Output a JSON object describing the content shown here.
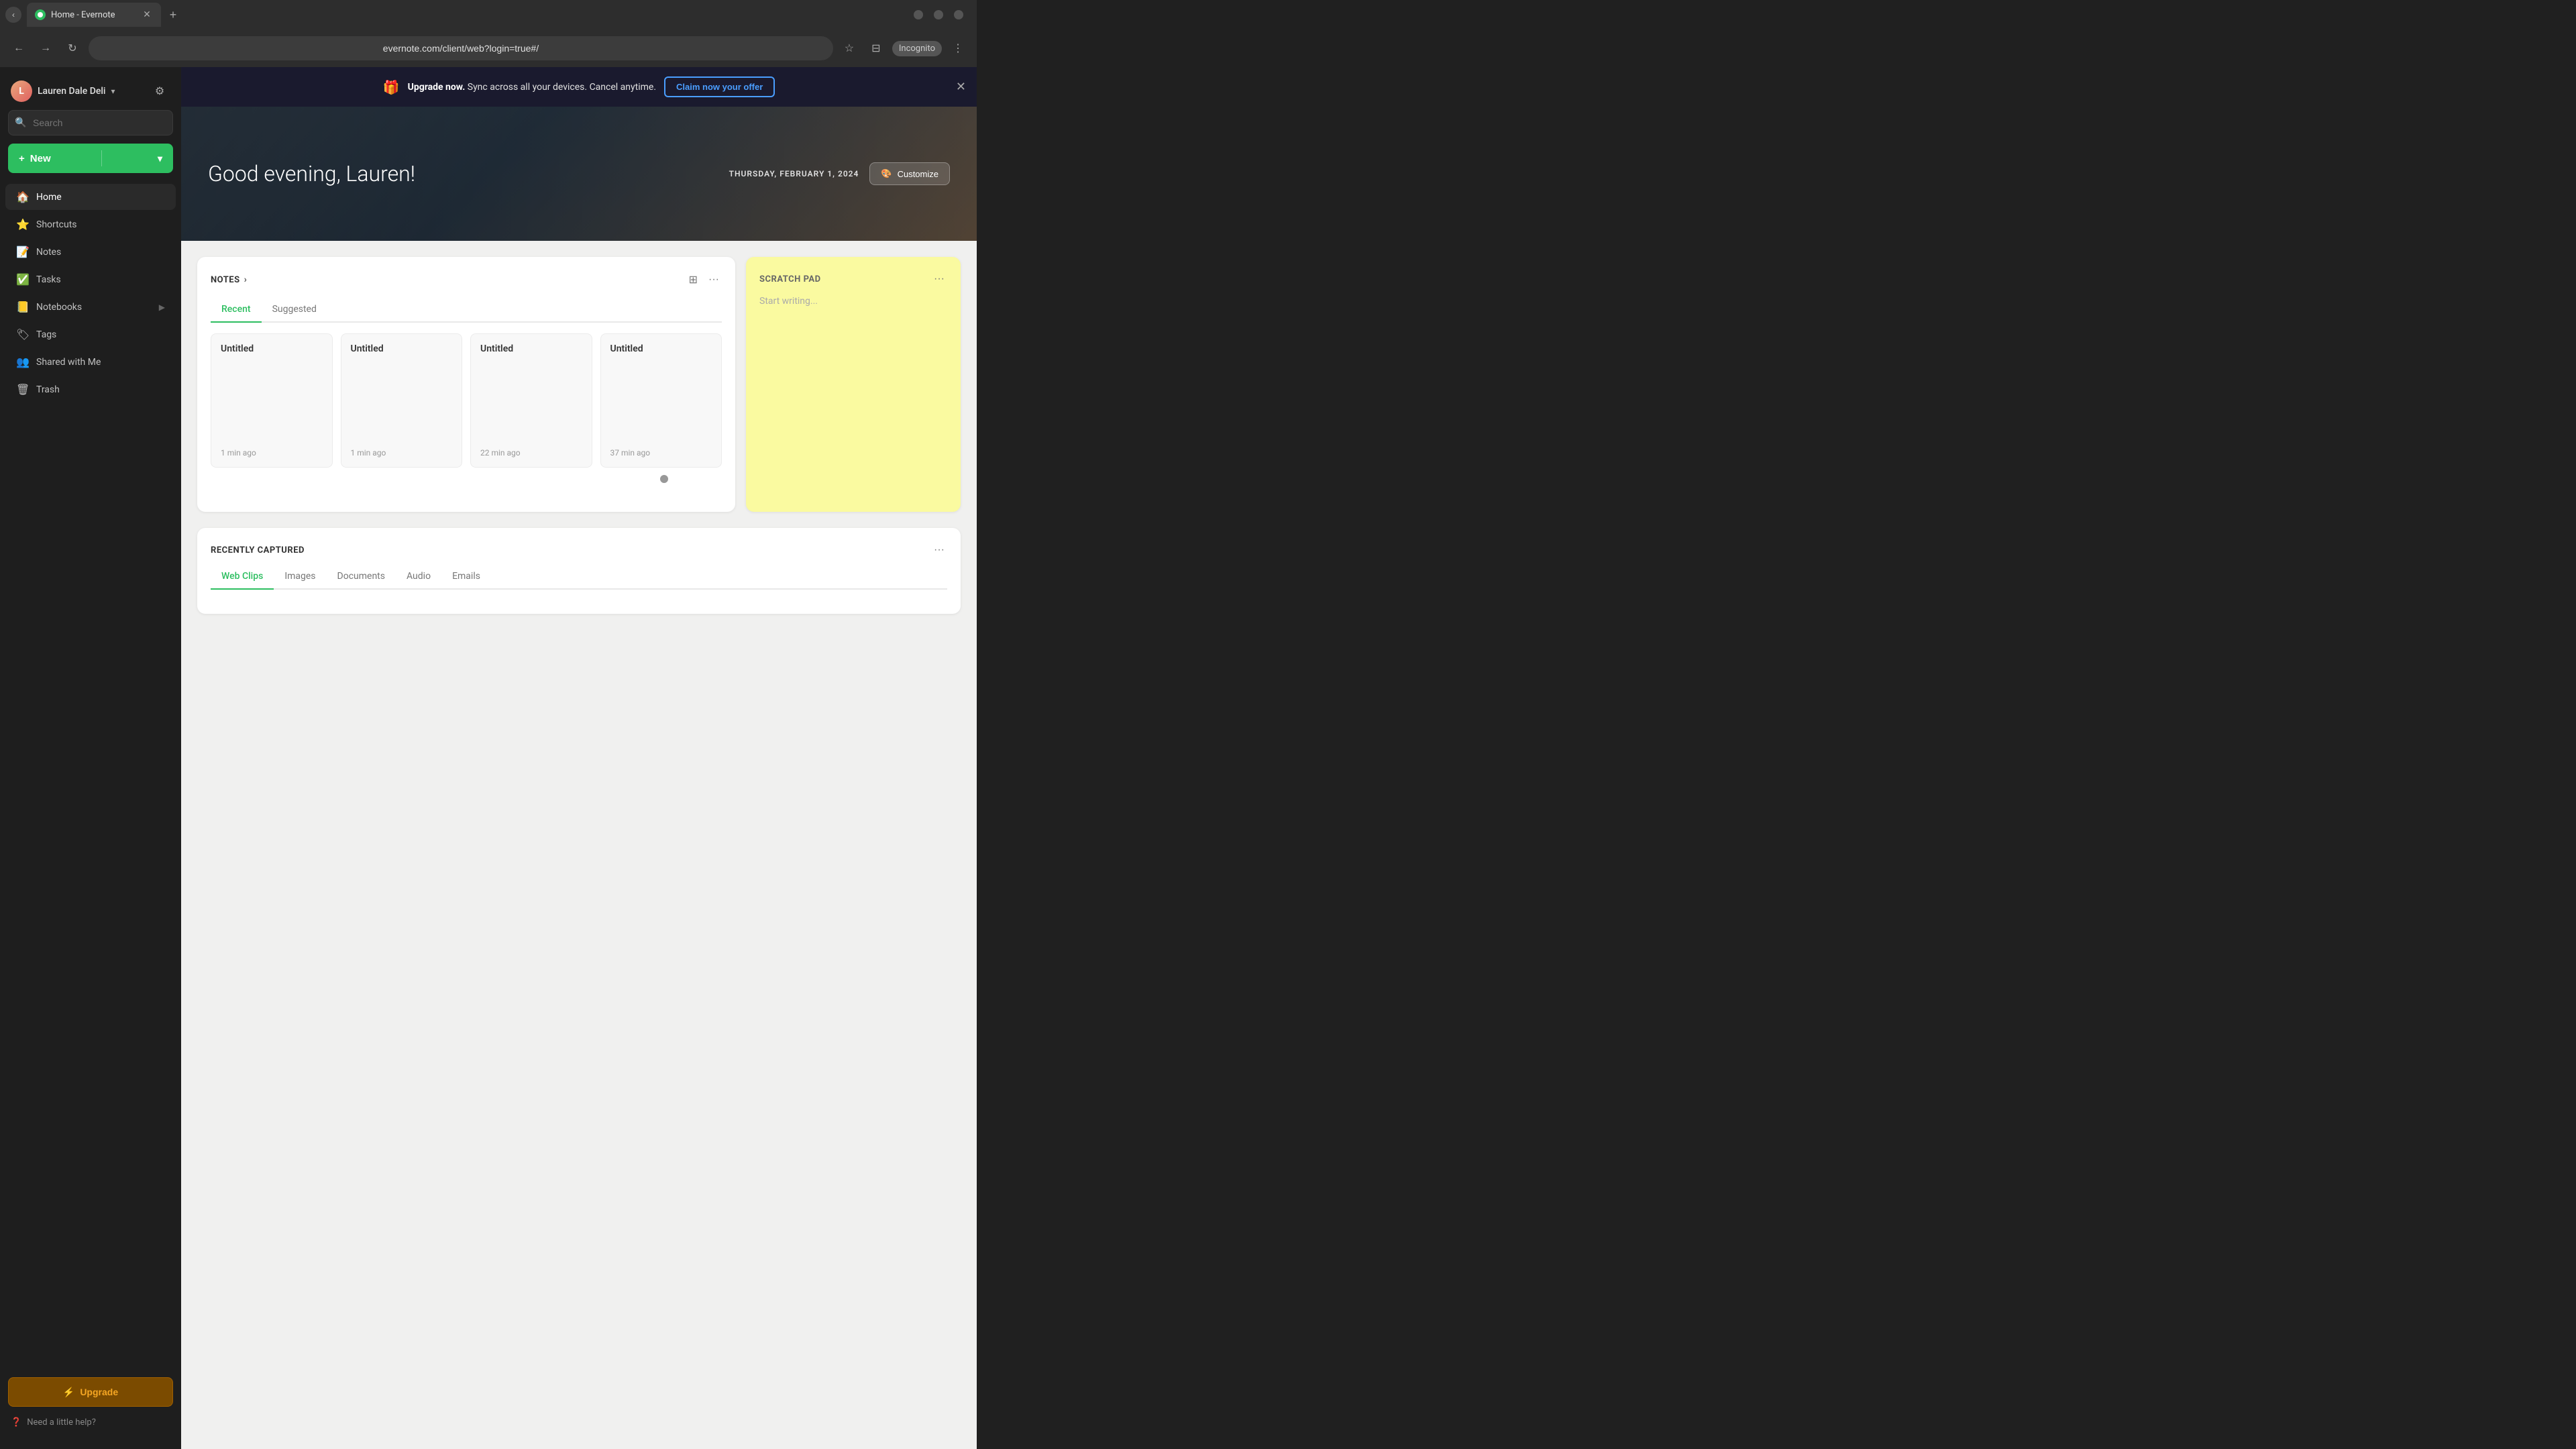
{
  "browser": {
    "tab_title": "Home - Evernote",
    "favicon_color": "#2dbe60",
    "url": "evernote.com/client/web?login=true#/",
    "incognito_label": "Incognito",
    "new_tab_tooltip": "New tab"
  },
  "banner": {
    "icon": "🎁",
    "text_before": "Upgrade now.",
    "text_main": " Sync across all your devices. Cancel anytime.",
    "cta_label": "Claim now your offer"
  },
  "header": {
    "greeting": "Good evening, Lauren!",
    "date": "THURSDAY, FEBRUARY 1, 2024",
    "customize_label": "Customize"
  },
  "sidebar": {
    "username": "Lauren Dale Deli",
    "search_placeholder": "Search",
    "new_button_label": "New",
    "nav_items": [
      {
        "id": "home",
        "label": "Home",
        "icon": "🏠"
      },
      {
        "id": "shortcuts",
        "label": "Shortcuts",
        "icon": "⭐"
      },
      {
        "id": "notes",
        "label": "Notes",
        "icon": "📝"
      },
      {
        "id": "tasks",
        "label": "Tasks",
        "icon": "✅"
      },
      {
        "id": "notebooks",
        "label": "Notebooks",
        "icon": "📒"
      },
      {
        "id": "tags",
        "label": "Tags",
        "icon": "🏷"
      },
      {
        "id": "shared",
        "label": "Shared with Me",
        "icon": "👥"
      },
      {
        "id": "trash",
        "label": "Trash",
        "icon": "🗑"
      }
    ],
    "upgrade_label": "Upgrade",
    "help_label": "Need a little help?"
  },
  "notes_widget": {
    "title": "NOTES",
    "tabs": [
      "Recent",
      "Suggested"
    ],
    "active_tab": "Recent",
    "notes": [
      {
        "title": "Untitled",
        "time": "1 min ago"
      },
      {
        "title": "Untitled",
        "time": "1 min ago"
      },
      {
        "title": "Untitled",
        "time": "22 min ago"
      },
      {
        "title": "Untitled",
        "time": "37 min ago"
      }
    ]
  },
  "scratch_pad": {
    "title": "SCRATCH PAD",
    "placeholder": "Start writing..."
  },
  "recently_captured": {
    "title": "RECENTLY CAPTURED",
    "tabs": [
      "Web Clips",
      "Images",
      "Documents",
      "Audio",
      "Emails"
    ],
    "active_tab": "Web Clips"
  }
}
